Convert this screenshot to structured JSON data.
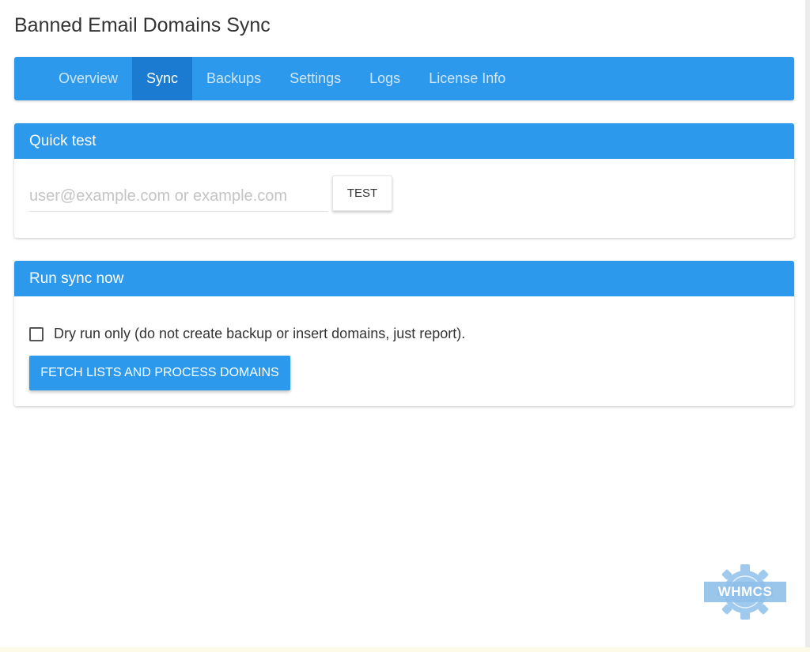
{
  "page": {
    "title": "Banned Email Domains Sync"
  },
  "nav": {
    "tabs": [
      {
        "label": "Overview",
        "active": false
      },
      {
        "label": "Sync",
        "active": true
      },
      {
        "label": "Backups",
        "active": false
      },
      {
        "label": "Settings",
        "active": false
      },
      {
        "label": "Logs",
        "active": false
      },
      {
        "label": "License Info",
        "active": false
      }
    ]
  },
  "quick_test": {
    "title": "Quick test",
    "input_value": "",
    "input_placeholder": "user@example.com or example.com",
    "button_label": "TEST"
  },
  "run_sync": {
    "title": "Run sync now",
    "dry_run_label": "Dry run only (do not create backup or insert domains, just report).",
    "dry_run_checked": false,
    "button_label": "FETCH LISTS AND PROCESS DOMAINS"
  },
  "watermark": {
    "text": "WHMCS"
  },
  "colors": {
    "primary": "#2c99ed",
    "nav_active": "#1a7bd0",
    "watermark": "#8fc0ea"
  }
}
